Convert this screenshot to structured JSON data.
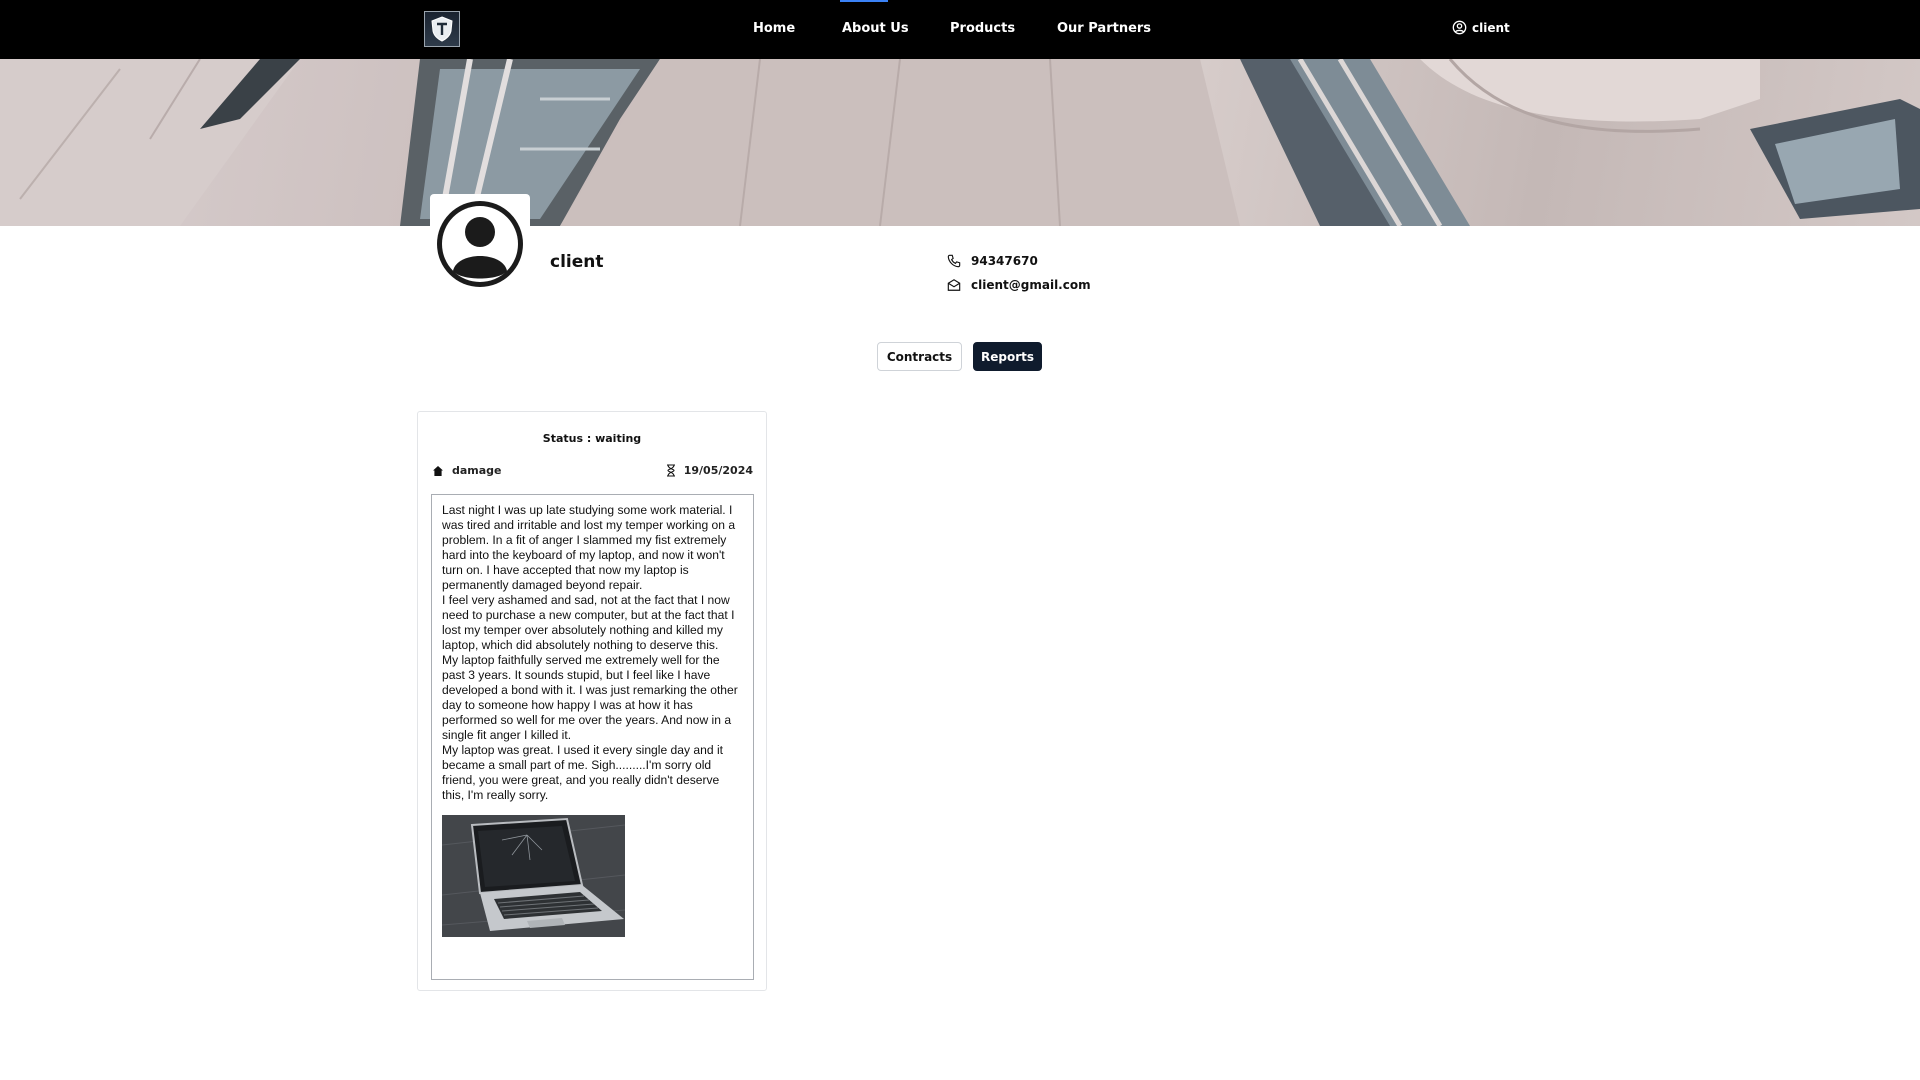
{
  "nav": {
    "links": [
      {
        "label": "Home"
      },
      {
        "label": "About Us"
      },
      {
        "label": "Products"
      },
      {
        "label": "Our Partners"
      }
    ],
    "user_label": "client",
    "active_color": "#3b82f6"
  },
  "profile": {
    "name": "client",
    "phone": "94347670",
    "email": "client@gmail.com"
  },
  "tabs": {
    "contracts_label": "Contracts",
    "reports_label": "Reports",
    "selected": "Reports"
  },
  "report": {
    "status": "Status : waiting",
    "type": "damage",
    "date": "19/05/2024",
    "paragraphs": [
      "Last night I was up late studying some work material. I was tired and irritable and lost my temper working on a problem. In a fit of anger I slammed my fist extremely hard into the keyboard of my laptop, and now it won't turn on. I have accepted that now my laptop is permanently damaged beyond repair.",
      "I feel very ashamed and sad, not at the fact that I now need to purchase a new computer, but at the fact that I lost my temper over absolutely nothing and killed my laptop, which did absolutely nothing to deserve this.",
      "My laptop faithfully served me extremely well for the past 3 years. It sounds stupid, but I feel like I have developed a bond with it. I was just remarking the other day to someone how happy I was at how it has performed so well for me over the years. And now in a single fit anger I killed it.",
      "My laptop was great. I used it every single day and it became a small part of me. Sigh.........I'm sorry old friend, you were great, and you really didn't deserve this, I'm really sorry."
    ]
  },
  "colors": {
    "navbar": "#000000",
    "reports_button": "#0f1b2d"
  }
}
